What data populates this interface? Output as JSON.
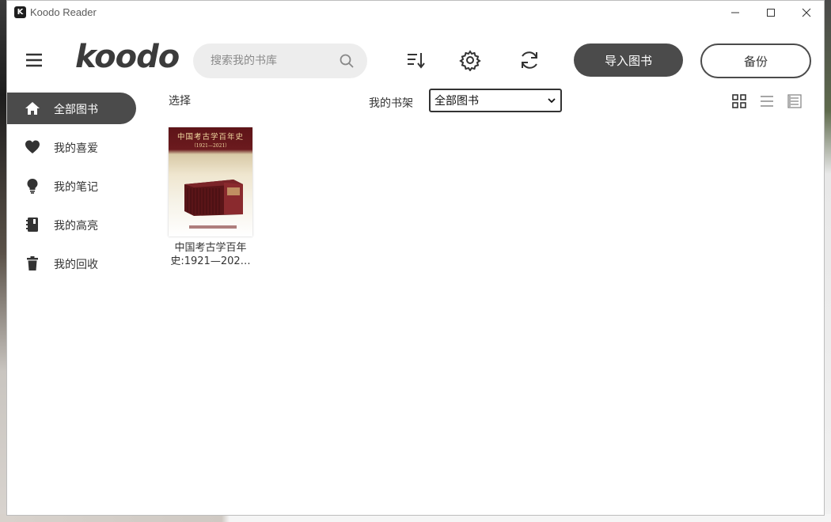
{
  "window": {
    "title": "Koodo Reader",
    "app_icon_glyph": "K"
  },
  "header": {
    "logo": "koodo",
    "search_placeholder": "搜索我的书库",
    "import_label": "导入图书",
    "backup_label": "备份"
  },
  "sidebar": {
    "items": [
      {
        "label": "全部图书",
        "icon": "home-icon",
        "active": true
      },
      {
        "label": "我的喜爱",
        "icon": "heart-icon",
        "active": false
      },
      {
        "label": "我的笔记",
        "icon": "lightbulb-icon",
        "active": false
      },
      {
        "label": "我的高亮",
        "icon": "notebook-icon",
        "active": false
      },
      {
        "label": "我的回收",
        "icon": "trash-icon",
        "active": false
      }
    ]
  },
  "toolbar": {
    "select_label": "选择",
    "shelf_label": "我的书架",
    "shelf_value": "全部图书"
  },
  "books": [
    {
      "title": "中国考古学百年史:1921—202…",
      "cover_title": "中国考古学百年史",
      "cover_subtitle": "（1921—2021）"
    }
  ],
  "colors": {
    "accent": "#4b4b4b",
    "cover_maroon": "#6b1a1e"
  }
}
